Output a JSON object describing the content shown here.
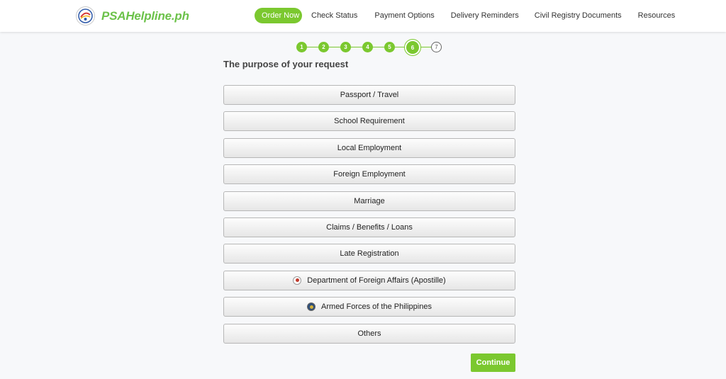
{
  "header": {
    "logo_text": "PSAHelpline.ph",
    "logo_icon": "psa-emblem-icon",
    "nav": [
      {
        "label": "Order Now"
      },
      {
        "label": "Check Status"
      },
      {
        "label": "Payment Options"
      },
      {
        "label": "Delivery Reminders"
      },
      {
        "label": "Civil Registry Documents"
      },
      {
        "label": "Resources"
      }
    ]
  },
  "stepper": {
    "current": 6,
    "total": 7,
    "steps": [
      "1",
      "2",
      "3",
      "4",
      "5",
      "6",
      "7"
    ]
  },
  "form": {
    "question": "The purpose of your request",
    "options": [
      {
        "label": "Passport / Travel"
      },
      {
        "label": "School Requirement"
      },
      {
        "label": "Local Employment"
      },
      {
        "label": "Foreign Employment"
      },
      {
        "label": "Marriage"
      },
      {
        "label": "Claims / Benefits / Loans"
      },
      {
        "label": "Late Registration"
      },
      {
        "label": "Department of Foreign Affairs (Apostille)",
        "icon": "dfa-seal-icon"
      },
      {
        "label": "Armed Forces of the Philippines",
        "icon": "afp-seal-icon"
      },
      {
        "label": "Others"
      }
    ],
    "continue_label": "Continue"
  },
  "colors": {
    "accent": "#7bc82f",
    "logo_green": "#6cc24a",
    "background": "#f7f8fa"
  }
}
